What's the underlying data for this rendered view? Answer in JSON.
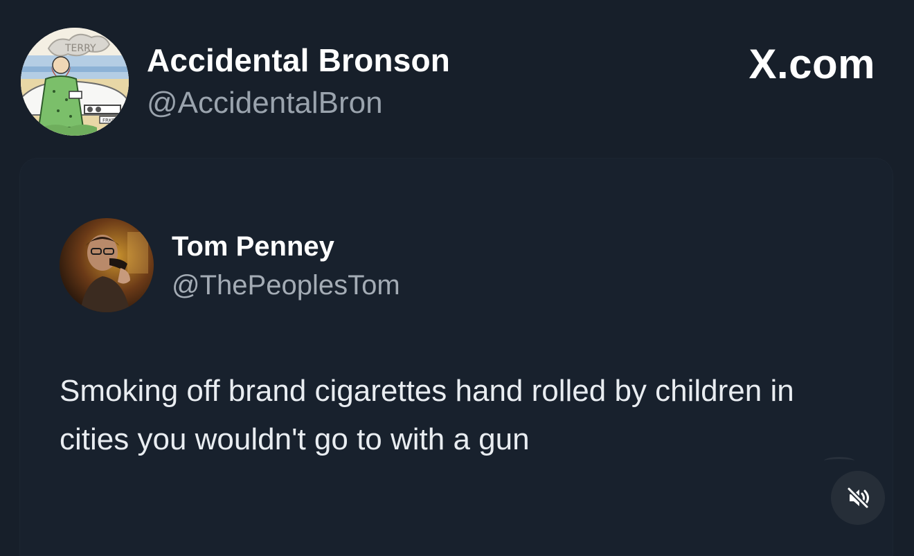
{
  "brand_label": "X.com",
  "poster": {
    "name": "Accidental Bronson",
    "handle": "@AccidentalBron",
    "avatar_icon": "cartoon-avatar-icon"
  },
  "quoted_post": {
    "author": {
      "name": "Tom Penney",
      "handle": "@ThePeoplesTom",
      "avatar_icon": "photo-avatar-icon"
    },
    "text": "Smoking off brand cigarettes hand rolled by children in cities you wouldn't go to with a gun"
  },
  "controls": {
    "mute_icon": "muted-speaker-icon"
  },
  "colors": {
    "background": "#171f2a",
    "card": "#18212d",
    "handle_text": "#9aa3ad",
    "body_text": "#e9edf1"
  }
}
